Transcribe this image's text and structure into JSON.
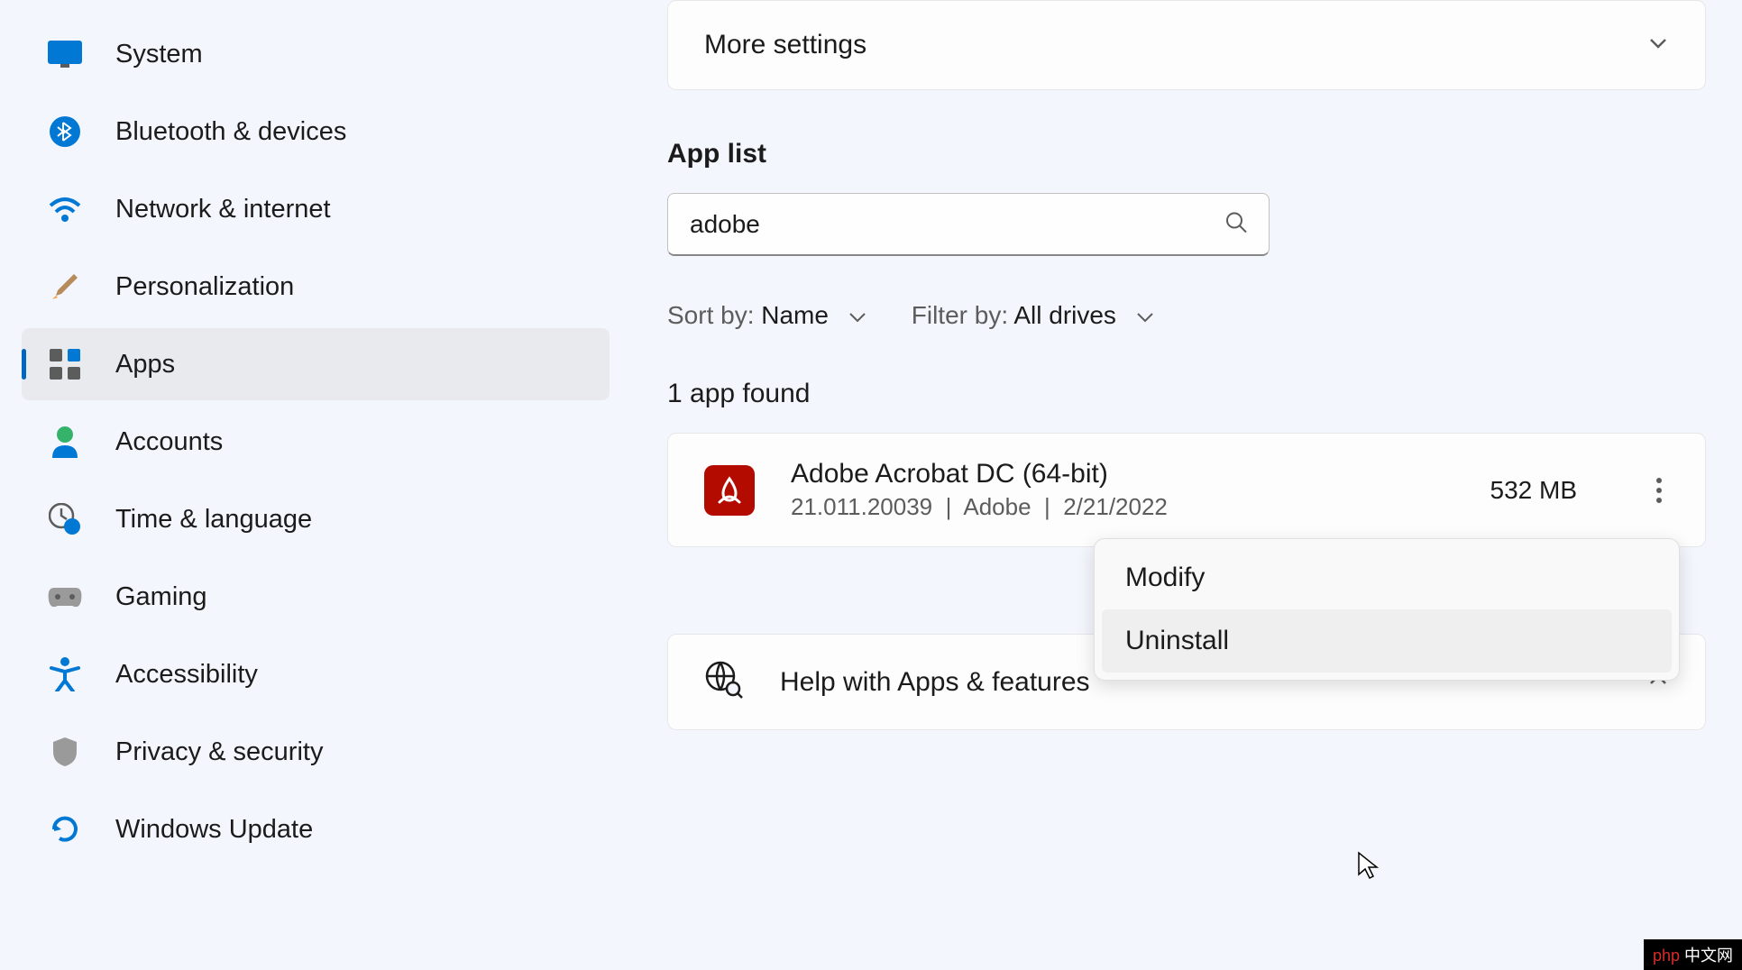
{
  "sidebar": {
    "items": [
      {
        "label": "System"
      },
      {
        "label": "Bluetooth & devices"
      },
      {
        "label": "Network & internet"
      },
      {
        "label": "Personalization"
      },
      {
        "label": "Apps"
      },
      {
        "label": "Accounts"
      },
      {
        "label": "Time & language"
      },
      {
        "label": "Gaming"
      },
      {
        "label": "Accessibility"
      },
      {
        "label": "Privacy & security"
      },
      {
        "label": "Windows Update"
      }
    ]
  },
  "main": {
    "more_settings": "More settings",
    "app_list_title": "App list",
    "search_value": "adobe",
    "sort_label": "Sort by:",
    "sort_value": "Name",
    "filter_label": "Filter by:",
    "filter_value": "All drives",
    "found_text": "1 app found",
    "app": {
      "name": "Adobe Acrobat DC (64-bit)",
      "version": "21.011.20039",
      "publisher": "Adobe",
      "date": "2/21/2022",
      "size": "532 MB"
    },
    "context": {
      "modify": "Modify",
      "uninstall": "Uninstall"
    },
    "help_title": "Help with Apps & features"
  },
  "watermark": {
    "php": "php",
    "rest": " 中文网"
  }
}
